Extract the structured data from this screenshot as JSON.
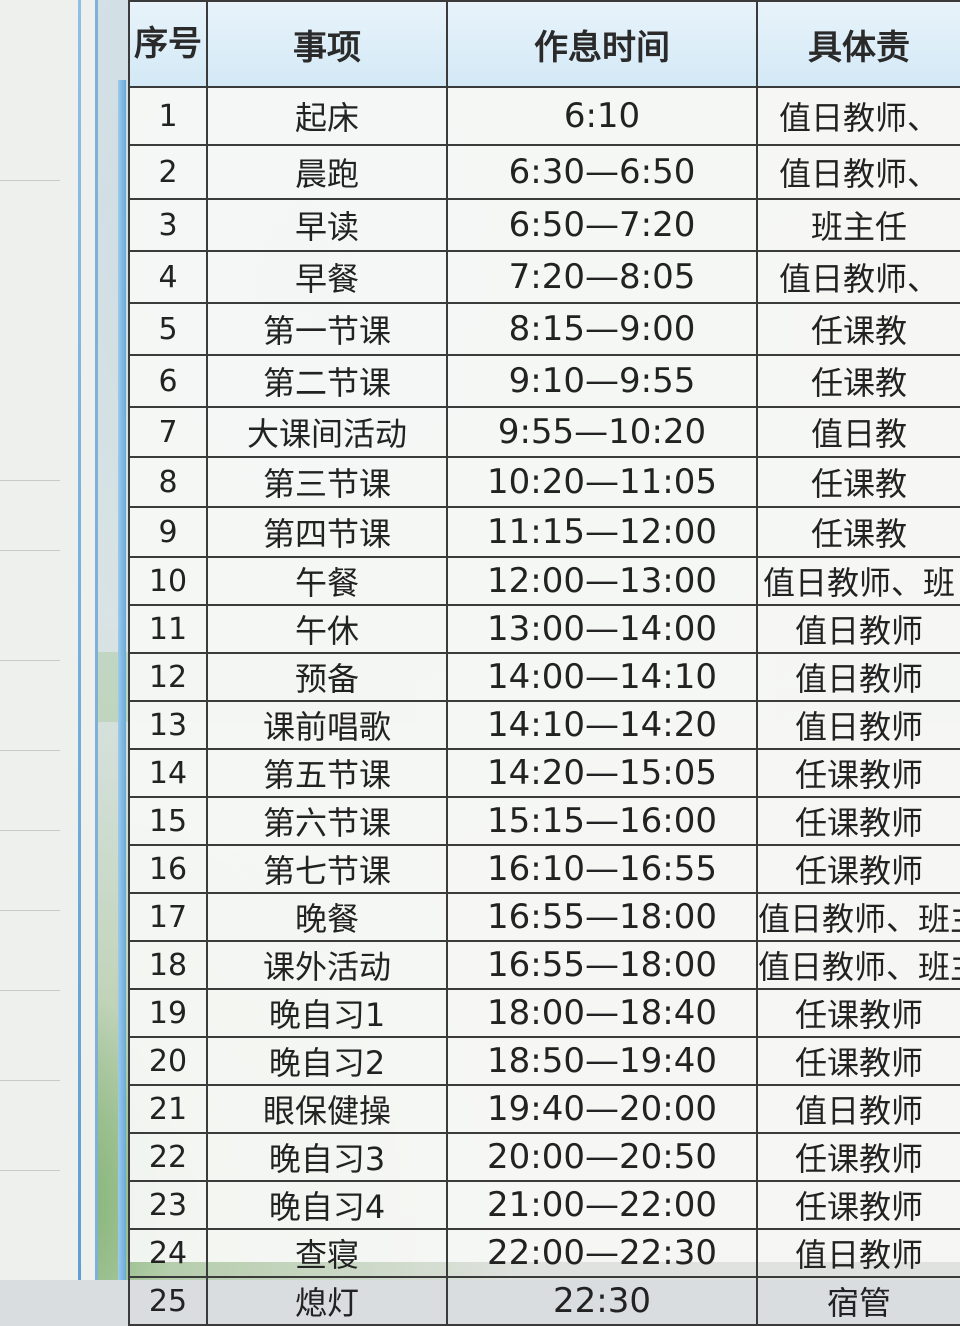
{
  "board": {
    "headers": {
      "number": "序号",
      "item": "事项",
      "time": "作息时间",
      "responsible": "具体责"
    },
    "rows": [
      {
        "no": "1",
        "item": "起床",
        "time": "6:10",
        "responsible": "值日教师、"
      },
      {
        "no": "2",
        "item": "晨跑",
        "time": "6:30—6:50",
        "responsible": "值日教师、"
      },
      {
        "no": "3",
        "item": "早读",
        "time": "6:50—7:20",
        "responsible": "班主任"
      },
      {
        "no": "4",
        "item": "早餐",
        "time": "7:20—8:05",
        "responsible": "值日教师、"
      },
      {
        "no": "5",
        "item": "第一节课",
        "time": "8:15—9:00",
        "responsible": "任课教"
      },
      {
        "no": "6",
        "item": "第二节课",
        "time": "9:10—9:55",
        "responsible": "任课教"
      },
      {
        "no": "7",
        "item": "大课间活动",
        "time": "9:55—10:20",
        "responsible": "值日教"
      },
      {
        "no": "8",
        "item": "第三节课",
        "time": "10:20—11:05",
        "responsible": "任课教"
      },
      {
        "no": "9",
        "item": "第四节课",
        "time": "11:15—12:00",
        "responsible": "任课教"
      },
      {
        "no": "10",
        "item": "午餐",
        "time": "12:00—13:00",
        "responsible": "值日教师、班"
      },
      {
        "no": "11",
        "item": "午休",
        "time": "13:00—14:00",
        "responsible": "值日教师"
      },
      {
        "no": "12",
        "item": "预备",
        "time": "14:00—14:10",
        "responsible": "值日教师"
      },
      {
        "no": "13",
        "item": "课前唱歌",
        "time": "14:10—14:20",
        "responsible": "值日教师"
      },
      {
        "no": "14",
        "item": "第五节课",
        "time": "14:20—15:05",
        "responsible": "任课教师"
      },
      {
        "no": "15",
        "item": "第六节课",
        "time": "15:15—16:00",
        "responsible": "任课教师"
      },
      {
        "no": "16",
        "item": "第七节课",
        "time": "16:10—16:55",
        "responsible": "任课教师"
      },
      {
        "no": "17",
        "item": "晚餐",
        "time": "16:55—18:00",
        "responsible": "值日教师、班主"
      },
      {
        "no": "18",
        "item": "课外活动",
        "time": "16:55—18:00",
        "responsible": "值日教师、班主"
      },
      {
        "no": "19",
        "item": "晚自习1",
        "time": "18:00—18:40",
        "responsible": "任课教师"
      },
      {
        "no": "20",
        "item": "晚自习2",
        "time": "18:50—19:40",
        "responsible": "任课教师"
      },
      {
        "no": "21",
        "item": "眼保健操",
        "time": "19:40—20:00",
        "responsible": "值日教师"
      },
      {
        "no": "22",
        "item": "晚自习3",
        "time": "20:00—20:50",
        "responsible": "任课教师"
      },
      {
        "no": "23",
        "item": "晚自习4",
        "time": "21:00—22:00",
        "responsible": "任课教师"
      },
      {
        "no": "24",
        "item": "查寝",
        "time": "22:00—22:30",
        "responsible": "值日教师"
      },
      {
        "no": "25",
        "item": "熄灯",
        "time": "22:30",
        "responsible": "宿管"
      }
    ]
  },
  "colors": {
    "header_bg": "#d3e9f6",
    "rail_blue": "#6aa9da",
    "grid_line": "#3b3b3b"
  }
}
